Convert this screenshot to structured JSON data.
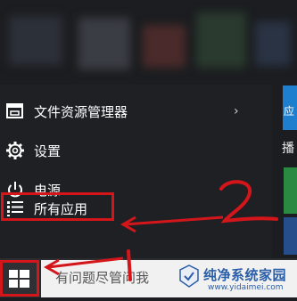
{
  "menu": {
    "items": [
      {
        "label": "文件资源管理器",
        "icon": "file-explorer-icon",
        "has_submenu": true
      },
      {
        "label": "设置",
        "icon": "gear-icon"
      },
      {
        "label": "电源",
        "icon": "power-icon"
      },
      {
        "label": "所有应用",
        "icon": "all-apps-icon"
      }
    ]
  },
  "tiles": {
    "right_tile_label": "应",
    "right_side_label": "播"
  },
  "taskbar": {
    "search_placeholder": "有问题尽管问我",
    "start_icon": "windows-logo-icon"
  },
  "annotations": {
    "arrow_1_label": "1",
    "arrow_2_label": "2",
    "highlight_color": "#d4161b"
  },
  "watermark": {
    "title": "纯净系统家园",
    "url": "www.yidaimei.com"
  }
}
